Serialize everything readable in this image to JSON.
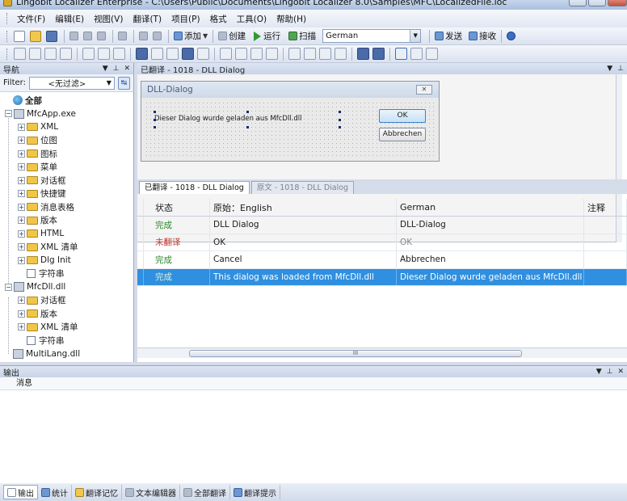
{
  "window": {
    "title": "Lingobit Localizer Enterprise - C:\\Users\\Public\\Documents\\Lingobit Localizer 8.0\\Samples\\MFC\\LocalizedFile.loc"
  },
  "menu": [
    "文件(F)",
    "编辑(E)",
    "视图(V)",
    "翻译(T)",
    "项目(P)",
    "格式",
    "工具(O)",
    "帮助(H)"
  ],
  "toolbar": {
    "add_label": "添加",
    "create_label": "创建",
    "run_label": "运行",
    "scan_label": "扫描",
    "language_value": "German",
    "send_label": "发送",
    "receive_label": "接收"
  },
  "nav": {
    "title": "导航",
    "filter_label": "Filter:",
    "filter_value": "<无过滤>",
    "tree": [
      {
        "label": "全部",
        "indent": 1,
        "icon": "globe",
        "bold": true
      },
      {
        "label": "MfcApp.exe",
        "indent": 0,
        "icon": "exe",
        "expander": "−"
      },
      {
        "label": "XML",
        "indent": 2,
        "icon": "folder",
        "expander": "+"
      },
      {
        "label": "位图",
        "indent": 2,
        "icon": "folder",
        "expander": "+"
      },
      {
        "label": "图标",
        "indent": 2,
        "icon": "folder",
        "expander": "+"
      },
      {
        "label": "菜单",
        "indent": 2,
        "icon": "folder",
        "expander": "+"
      },
      {
        "label": "对话框",
        "indent": 2,
        "icon": "folder",
        "expander": "+"
      },
      {
        "label": "快捷键",
        "indent": 2,
        "icon": "folder",
        "expander": "+"
      },
      {
        "label": "消息表格",
        "indent": 2,
        "icon": "folder",
        "expander": "+"
      },
      {
        "label": "版本",
        "indent": 2,
        "icon": "folder",
        "expander": "+"
      },
      {
        "label": "HTML",
        "indent": 2,
        "icon": "folder",
        "expander": "+"
      },
      {
        "label": "XML 清单",
        "indent": 2,
        "icon": "folder",
        "expander": "+"
      },
      {
        "label": "Dlg Init",
        "indent": 2,
        "icon": "folder",
        "expander": "+"
      },
      {
        "label": "字符串",
        "indent": 2,
        "icon": "list"
      },
      {
        "label": "MfcDll.dll",
        "indent": 0,
        "icon": "exe",
        "expander": "−"
      },
      {
        "label": "对话框",
        "indent": 2,
        "icon": "folder",
        "expander": "+"
      },
      {
        "label": "版本",
        "indent": 2,
        "icon": "folder",
        "expander": "+"
      },
      {
        "label": "XML 清单",
        "indent": 2,
        "icon": "folder",
        "expander": "+"
      },
      {
        "label": "字符串",
        "indent": 2,
        "icon": "list"
      },
      {
        "label": "MultiLang.dll",
        "indent": 1,
        "icon": "exe"
      }
    ]
  },
  "main": {
    "panel_title": "已翻译 - 1018 - DLL Dialog",
    "dialog": {
      "title": "DLL-Dialog",
      "text": "Dieser Dialog wurde geladen aus MfcDll.dll",
      "ok_label": "OK",
      "cancel_label": "Abbrechen"
    },
    "tabs": [
      "已翻译 - 1018 - DLL Dialog",
      "原文 - 1018 - DLL Dialog"
    ],
    "grid": {
      "headers": [
        "状态",
        "原始：English",
        "German",
        "注释"
      ],
      "rows": [
        {
          "status": "完成",
          "status_type": "done",
          "original": "DLL Dialog",
          "translation": "DLL-Dialog",
          "note": ""
        },
        {
          "status": "未翻译",
          "status_type": "untranslated",
          "original": "OK",
          "translation": "OK",
          "note": ""
        },
        {
          "status": "完成",
          "status_type": "done",
          "original": "Cancel",
          "translation": "Abbrechen",
          "note": ""
        },
        {
          "status": "完成",
          "status_type": "done",
          "original": "This dialog was loaded from MfcDll.dll",
          "translation": "Dieser Dialog wurde geladen aus MfcDll.dll",
          "note": "",
          "selected": true
        }
      ]
    }
  },
  "output": {
    "title": "输出",
    "message_header": "消息"
  },
  "bottom_tabs": [
    "输出",
    "统计",
    "翻译记忆",
    "文本编辑器",
    "全部翻译",
    "翻译提示"
  ],
  "colors": {
    "selection": "#2f8fe0",
    "done": "#2a8a2a",
    "untranslated": "#c0392b"
  }
}
